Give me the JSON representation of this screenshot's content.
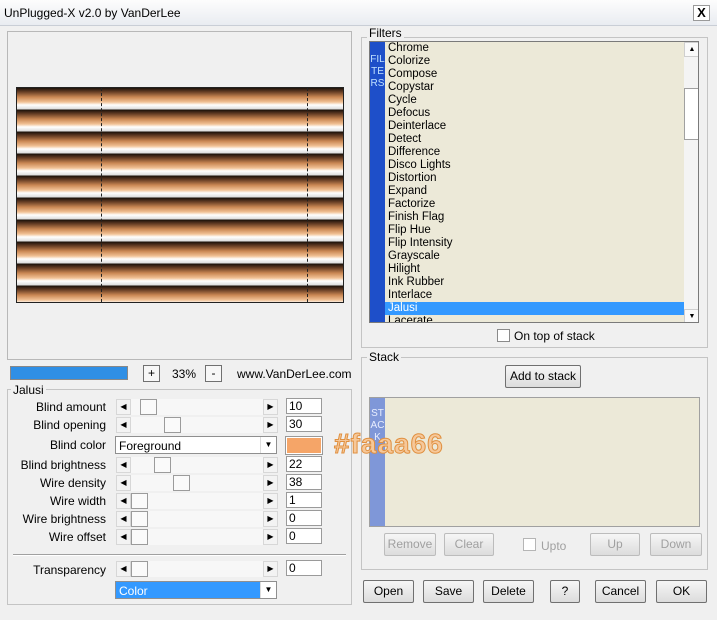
{
  "window": {
    "title": "UnPlugged-X v2.0 by VanDerLee",
    "close": "X"
  },
  "zoom": {
    "minus": "-",
    "plus": "+",
    "value": "33%",
    "website": "www.VanDerLee.com"
  },
  "progress": {
    "fraction": 1.0
  },
  "jalusi": {
    "label": "Jalusi",
    "blind_amount": {
      "label": "Blind amount",
      "value": "10"
    },
    "blind_opening": {
      "label": "Blind opening",
      "value": "30"
    },
    "blind_color": {
      "label": "Blind color",
      "selected": "Foreground",
      "swatch": "#f5a568"
    },
    "blind_brightness": {
      "label": "Blind brightness",
      "value": "22"
    },
    "wire_density": {
      "label": "Wire density",
      "value": "38"
    },
    "wire_width": {
      "label": "Wire width",
      "value": "1"
    },
    "wire_brightness": {
      "label": "Wire brightness",
      "value": "0"
    },
    "wire_offset": {
      "label": "Wire offset",
      "value": "0"
    }
  },
  "transparency": {
    "label": "Transparency",
    "value": "0",
    "mode": "Color"
  },
  "filters": {
    "label": "Filters",
    "side_label": "FILTERS",
    "items": [
      "Chrome",
      "Colorize",
      "Compose",
      "Copystar",
      "Cycle",
      "Defocus",
      "Deinterlace",
      "Detect",
      "Difference",
      "Disco Lights",
      "Distortion",
      "Expand",
      "Factorize",
      "Finish Flag",
      "Flip Hue",
      "Flip Intensity",
      "Grayscale",
      "Hilight",
      "Ink Rubber",
      "Interlace",
      "Jalusi",
      "Lacerate"
    ],
    "selected": "Jalusi",
    "on_top_label": "On top of stack"
  },
  "stack": {
    "label": "Stack",
    "side_label": "STACK",
    "add_label": "Add to stack",
    "remove_label": "Remove",
    "clear_label": "Clear",
    "upto_label": "Upto",
    "up_label": "Up",
    "down_label": "Down"
  },
  "buttons": {
    "open": "Open",
    "save": "Save",
    "delete": "Delete",
    "help": "?",
    "cancel": "Cancel",
    "ok": "OK"
  },
  "watermark": "#faaa66",
  "colors": {
    "accent": "#3399ff",
    "filter_side": "#1e4fc9",
    "stack_side": "#7f97d8"
  }
}
